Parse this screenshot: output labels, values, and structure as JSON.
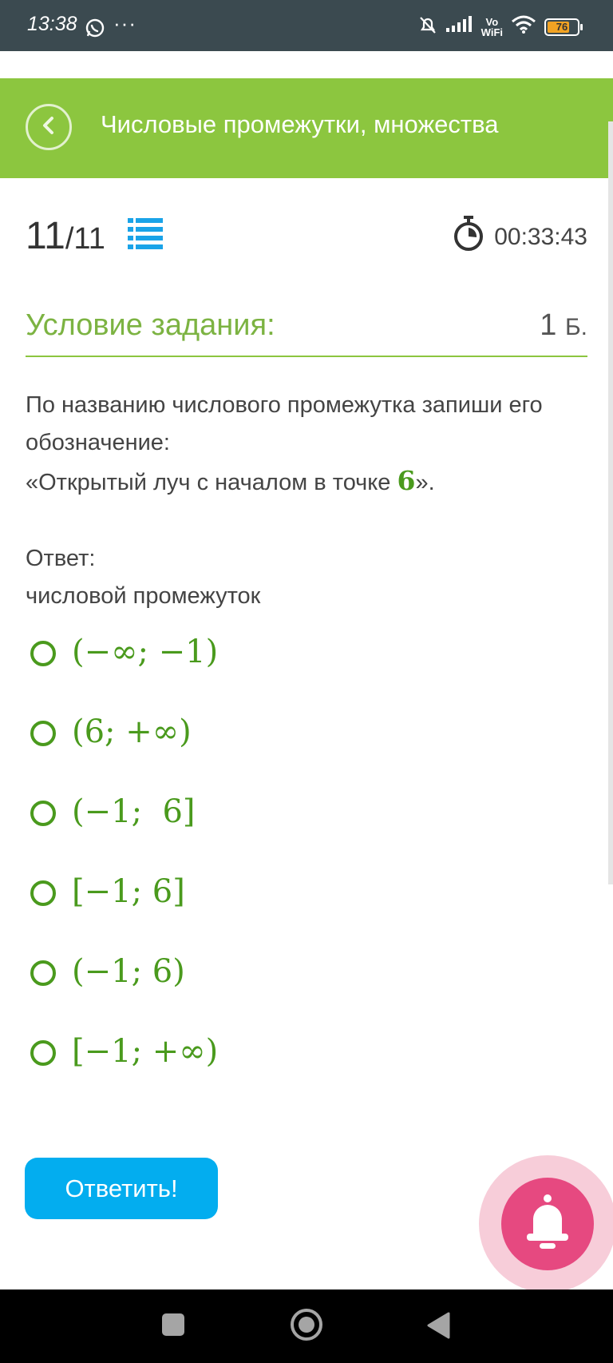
{
  "status_bar": {
    "time": "13:38",
    "dots": "···",
    "vowifi": [
      "Vo",
      "WiFi"
    ],
    "battery": "76",
    "battery_level": 0.76,
    "icons": [
      "whatsapp-icon",
      "mute-bell-icon",
      "signal-icon",
      "wifi-icon",
      "battery-icon"
    ]
  },
  "header": {
    "title": "Числовые промежутки, множества",
    "back_icon": "chevron-left-icon",
    "color": "#8cc63f"
  },
  "progress": {
    "current": "11",
    "total": "/11",
    "list_icon": "list-icon"
  },
  "timer": {
    "value": "00:33:43",
    "icon": "stopwatch-icon"
  },
  "condition": {
    "title": "Условие задания:",
    "points": "1",
    "points_unit": "Б."
  },
  "question": {
    "line1": "По названию числового промежутка запиши его обозначение:",
    "line2_before": "«Открытый луч с началом в точке ",
    "number": "6",
    "line2_after": "»."
  },
  "answer": {
    "label": "Ответ:",
    "sublabel": "числовой промежуток"
  },
  "options": [
    "(−∞; −1)",
    "(6; +∞)",
    "(−1;  6]",
    "[−1; 6]",
    "(−1; 6)",
    "[−1; +∞)"
  ],
  "submit_label": "Ответить!",
  "notification_icon": "bell-icon",
  "colors": {
    "accent_green": "#8cc63f",
    "option_green": "#4a9a1d",
    "button_blue": "#03adef",
    "bell_pink": "#e64980"
  }
}
